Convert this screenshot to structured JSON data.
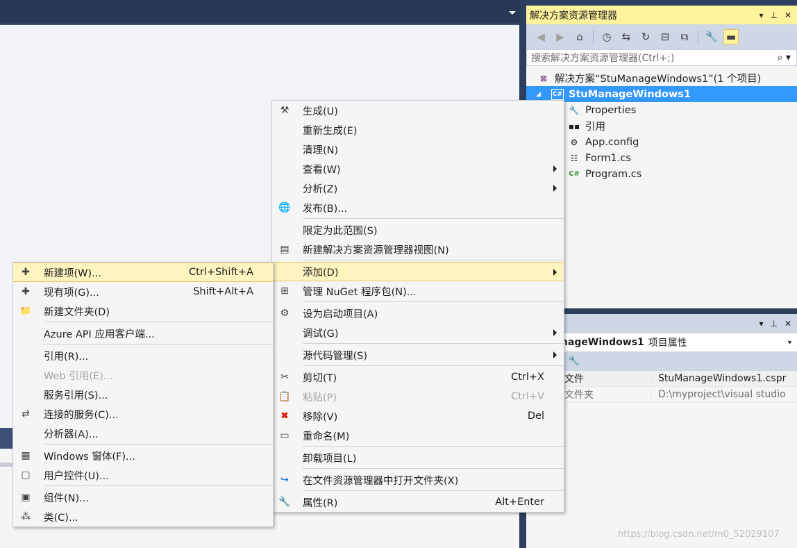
{
  "solution_explorer": {
    "title": "解决方案资源管理器",
    "title_buttons": [
      "▾",
      "⊥",
      "✕"
    ],
    "toolbar": [
      {
        "icon": "back-icon",
        "glyph": "◀",
        "dim": true
      },
      {
        "icon": "forward-icon",
        "glyph": "▶",
        "dim": true
      },
      {
        "icon": "home-icon",
        "glyph": "⌂",
        "dim": false
      },
      {
        "icon": "history-icon",
        "glyph": "◷",
        "dim": false
      },
      {
        "icon": "sync-icon",
        "glyph": "⇆",
        "dim": false
      },
      {
        "icon": "refresh-icon",
        "glyph": "↻",
        "dim": false
      },
      {
        "icon": "collapse-all-icon",
        "glyph": "⊟",
        "dim": false
      },
      {
        "icon": "copy-icon",
        "glyph": "⧉",
        "dim": false
      },
      {
        "icon": "properties-wrench-icon",
        "glyph": "🔧",
        "dim": false
      },
      {
        "icon": "preview-toggle-icon",
        "glyph": "▬",
        "dim": false,
        "active": true
      }
    ],
    "search_placeholder": "搜索解决方案资源管理器(Ctrl+;)",
    "search_icon": "⌕ ▾",
    "tree": {
      "solution": "解决方案“StuManageWindows1”(1 个项目)",
      "project": "StuManageWindows1",
      "project_expand": "◢",
      "items": [
        {
          "label": "Properties",
          "icon": "wrench-icon",
          "glyph": "🔧"
        },
        {
          "label": "引用",
          "icon": "references-icon",
          "glyph": "▪▪"
        },
        {
          "label": "App.config",
          "icon": "config-file-icon",
          "glyph": "⚙"
        },
        {
          "label": "Form1.cs",
          "icon": "form-icon",
          "glyph": "☷"
        },
        {
          "label": "Program.cs",
          "icon": "csharp-file-icon",
          "glyph": "C#"
        }
      ]
    }
  },
  "properties_panel": {
    "title_buttons": [
      "▾",
      "⊥",
      "✕"
    ],
    "object_name": "nageWindows1",
    "object_type": "项目属性",
    "dropdown": "▾",
    "toolbar_icon": "🔧",
    "rows": [
      {
        "key": "文件",
        "value": "StuManageWindows1.cspr"
      },
      {
        "key": "文件夹",
        "value": "D:\\myproject\\visual studio"
      }
    ]
  },
  "project_menu": [
    {
      "type": "item",
      "label": "生成(U)",
      "icon": "build-icon",
      "glyph": "⚒"
    },
    {
      "type": "item",
      "label": "重新生成(E)"
    },
    {
      "type": "item",
      "label": "清理(N)"
    },
    {
      "type": "item",
      "label": "查看(W)",
      "submenu": true
    },
    {
      "type": "item",
      "label": "分析(Z)",
      "submenu": true
    },
    {
      "type": "item",
      "label": "发布(B)...",
      "icon": "publish-globe-icon",
      "glyph": "🌐"
    },
    {
      "type": "sep"
    },
    {
      "type": "item",
      "label": "限定为此范围(S)"
    },
    {
      "type": "item",
      "label": "新建解决方案资源管理器视图(N)",
      "icon": "new-view-icon",
      "glyph": "▤"
    },
    {
      "type": "sep"
    },
    {
      "type": "item",
      "label": "添加(D)",
      "submenu": true,
      "highlight": true
    },
    {
      "type": "item",
      "label": "管理 NuGet 程序包(N)...",
      "icon": "nuget-package-icon",
      "glyph": "⊞"
    },
    {
      "type": "sep"
    },
    {
      "type": "item",
      "label": "设为启动项目(A)",
      "icon": "gear-icon",
      "glyph": "⚙"
    },
    {
      "type": "item",
      "label": "调试(G)",
      "submenu": true
    },
    {
      "type": "sep"
    },
    {
      "type": "item",
      "label": "源代码管理(S)",
      "submenu": true
    },
    {
      "type": "sep"
    },
    {
      "type": "item",
      "label": "剪切(T)",
      "shortcut": "Ctrl+X",
      "icon": "cut-icon",
      "glyph": "✂"
    },
    {
      "type": "item",
      "label": "粘贴(P)",
      "shortcut": "Ctrl+V",
      "icon": "paste-icon",
      "glyph": "📋",
      "disabled": true
    },
    {
      "type": "item",
      "label": "移除(V)",
      "shortcut": "Del",
      "icon": "remove-x-icon",
      "glyph": "✖",
      "color": "red"
    },
    {
      "type": "item",
      "label": "重命名(M)",
      "icon": "rename-icon",
      "glyph": "▭"
    },
    {
      "type": "sep"
    },
    {
      "type": "item",
      "label": "卸载项目(L)"
    },
    {
      "type": "sep"
    },
    {
      "type": "item",
      "label": "在文件资源管理器中打开文件夹(X)",
      "icon": "open-folder-arrow-icon",
      "glyph": "↪",
      "color": "blue"
    },
    {
      "type": "sep"
    },
    {
      "type": "item",
      "label": "属性(R)",
      "shortcut": "Alt+Enter",
      "icon": "wrench-icon",
      "glyph": "🔧"
    }
  ],
  "add_submenu": [
    {
      "type": "item",
      "label": "新建项(W)...",
      "shortcut": "Ctrl+Shift+A",
      "icon": "new-item-icon",
      "glyph": "✚",
      "highlight": true
    },
    {
      "type": "item",
      "label": "现有项(G)...",
      "shortcut": "Shift+Alt+A",
      "icon": "existing-item-icon",
      "glyph": "✚"
    },
    {
      "type": "item",
      "label": "新建文件夹(D)",
      "icon": "new-folder-icon",
      "glyph": "📁",
      "color": "gold"
    },
    {
      "type": "sep"
    },
    {
      "type": "item",
      "label": "Azure API 应用客户端..."
    },
    {
      "type": "sep"
    },
    {
      "type": "item",
      "label": "引用(R)..."
    },
    {
      "type": "item",
      "label": "Web 引用(E)...",
      "disabled": true
    },
    {
      "type": "item",
      "label": "服务引用(S)..."
    },
    {
      "type": "item",
      "label": "连接的服务(C)...",
      "icon": "connected-services-icon",
      "glyph": "⇄"
    },
    {
      "type": "item",
      "label": "分析器(A)..."
    },
    {
      "type": "sep"
    },
    {
      "type": "item",
      "label": "Windows 窗体(F)...",
      "icon": "windows-form-icon",
      "glyph": "▦"
    },
    {
      "type": "item",
      "label": "用户控件(U)...",
      "icon": "user-control-icon",
      "glyph": "▢"
    },
    {
      "type": "sep"
    },
    {
      "type": "item",
      "label": "组件(N)...",
      "icon": "component-icon",
      "glyph": "▣"
    },
    {
      "type": "item",
      "label": "类(C)...",
      "icon": "class-icon",
      "glyph": "⁂"
    }
  ],
  "watermark": "https://blog.csdn.net/m0_52029107"
}
